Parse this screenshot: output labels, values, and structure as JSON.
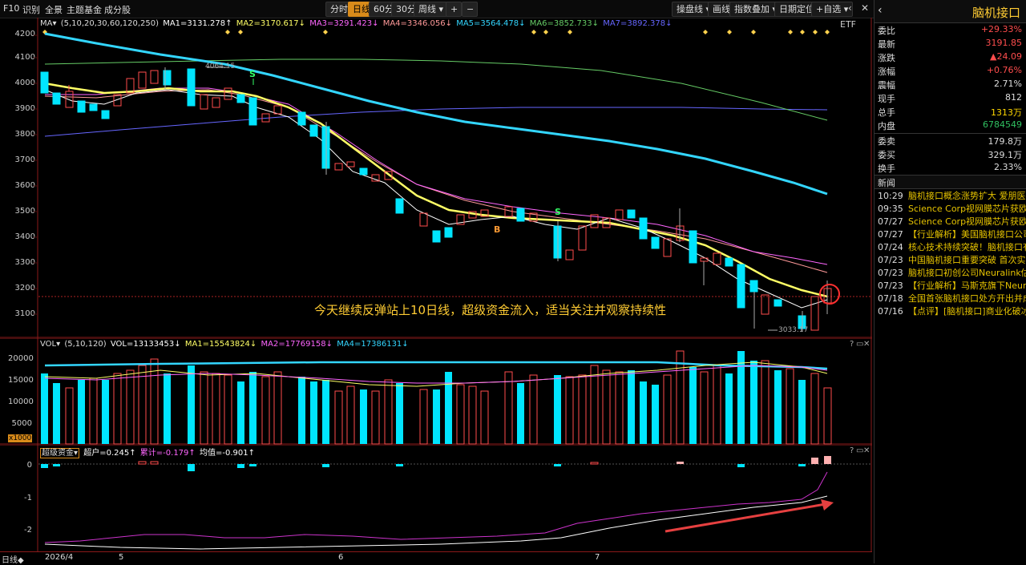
{
  "topbar": {
    "f10": "F10",
    "recognize": "识别",
    "fullscreen": "全景",
    "theme_fund": "主题基金",
    "components": "成分股",
    "tabs": [
      {
        "label": "分时",
        "active": false
      },
      {
        "label": "日线",
        "active": true
      },
      {
        "label": "60分",
        "active": false
      },
      {
        "label": "30分",
        "active": false
      },
      {
        "label": "周线 ▾",
        "active": false
      }
    ],
    "zoom_plus": "+",
    "zoom_minus": "−",
    "right_buttons": [
      "操盘线 ▾",
      "画线",
      "指数叠加 ▾",
      "日期定位",
      "+自选 ▾"
    ],
    "etf_tag": "ETF"
  },
  "main_chart": {
    "legend": {
      "ma_menu": "MA▾",
      "params": "(5,10,20,30,60,120,250)",
      "ma1": "MA1=3131.278↑",
      "ma2": "MA2=3170.617↓",
      "ma3": "MA3=3291.423↓",
      "ma4": "MA4=3346.056↓",
      "ma5": "MA5=3564.478↓",
      "ma6": "MA6=3852.733↓",
      "ma7": "MA7=3892.378↓"
    },
    "y_ticks": [
      "4200",
      "4100",
      "4000",
      "3900",
      "3800",
      "3700",
      "3600",
      "3500",
      "3400",
      "3300",
      "3200",
      "3100"
    ],
    "high_label": "4064.15",
    "low_label": "3033.17",
    "annotation": "今天继续反弹站上10日线，超级资金流入，适当关注并观察持续性",
    "signal_s": "S",
    "signal_b": "B"
  },
  "vol_chart": {
    "legend": {
      "menu": "VOL▾",
      "params": "(5,10,120)",
      "vol": "VOL=13133453↓",
      "ma1": "MA1=15543824↓",
      "ma2": "MA2=17769158↓",
      "ma4": "MA4=17386131↓"
    },
    "y_ticks": [
      "20000",
      "15000",
      "10000",
      "5000"
    ],
    "unit": "x1000"
  },
  "capital_chart": {
    "legend": {
      "menu": "超级资金▾",
      "super": "超户=0.245↑",
      "cum": "累计=-0.179↑",
      "avg": "均值=-0.901↑"
    },
    "y_ticks": [
      "0",
      "-1",
      "-2"
    ]
  },
  "bottom_axis": {
    "period": "日线◆",
    "labels": [
      "2026/4",
      "5",
      "6",
      "7"
    ]
  },
  "side": {
    "title": "脑机接口",
    "stats": [
      {
        "k": "委比",
        "v": "+29.33%",
        "color": "#ff4d4d"
      },
      {
        "k": "最新",
        "v": "3191.85",
        "color": "#ff4d4d"
      },
      {
        "k": "涨跌",
        "v": "▲24.09",
        "color": "#ff4d4d"
      },
      {
        "k": "涨幅",
        "v": "+0.76%",
        "color": "#ff4d4d"
      },
      {
        "k": "震幅",
        "v": "2.71%",
        "color": "#ddd"
      },
      {
        "k": "现手",
        "v": "812",
        "color": "#ddd"
      },
      {
        "k": "总手",
        "v": "1313万",
        "color": "#ffd700"
      },
      {
        "k": "内盘",
        "v": "6784549",
        "color": "#30c060"
      }
    ],
    "stats2": [
      {
        "k": "委卖",
        "v": "179.8万",
        "color": "#ddd"
      },
      {
        "k": "委买",
        "v": "329.1万",
        "color": "#ddd"
      },
      {
        "k": "换手",
        "v": "2.33%",
        "color": "#ddd"
      }
    ],
    "news_title": "新闻",
    "news": [
      {
        "t": "10:29",
        "h": "脑机接口概念涨势扩大 爱朋医疗"
      },
      {
        "t": "09:35",
        "h": "Science Corp视网膜芯片获欧盟"
      },
      {
        "t": "07/27",
        "h": "Science Corp视网膜芯片获欧盟"
      },
      {
        "t": "07/27",
        "h": "【行业解析】美国脑机接口公司"
      },
      {
        "t": "07/24",
        "h": "核心技术持续突破！脑机接口有"
      },
      {
        "t": "07/23",
        "h": "中国脑机接口重要突破 首次实现"
      },
      {
        "t": "07/23",
        "h": "脑机接口初创公司Neuralink估值"
      },
      {
        "t": "07/23",
        "h": "【行业解析】马斯克旗下Neuralink"
      },
      {
        "t": "07/18",
        "h": "全国首张脑机接口处方开出并成功"
      },
      {
        "t": "07/16",
        "h": "【点评】[脑机接口]商业化破冰"
      }
    ]
  },
  "colors": {
    "up": "#ff4d4d",
    "down": "#00e5ff",
    "ma1": "#ffffff",
    "ma2": "#ffff66",
    "ma3": "#ff66ff",
    "ma4": "#ff9999",
    "ma5": "#33d6ff",
    "ma6": "#66cc66",
    "ma7": "#6666ff"
  }
}
